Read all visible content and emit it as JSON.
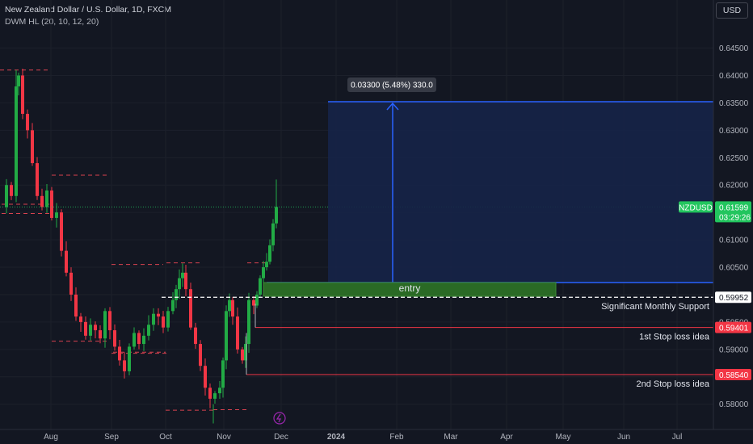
{
  "header": {
    "title": "New Zealand Dollar / U.S. Dollar, 1D, FXCM",
    "indicator": "DWM HL (20, 10, 12, 20)",
    "currency_button": "USD"
  },
  "colors": {
    "background": "#131722",
    "up_candle": "#22ab45",
    "down_candle": "#f23645",
    "accent_blue": "#2962ff",
    "measure_fill": "#162448",
    "entry_fill": "#2a6a25",
    "stop_line": "#f23645",
    "current_price": "#22c55e",
    "dashed_red": "#d8424f"
  },
  "chart_data": {
    "type": "candlestick",
    "symbol": "NZDUSD",
    "ylim": [
      0.577,
      0.6495
    ],
    "y_ticks": [
      "0.64500",
      "0.64000",
      "0.63500",
      "0.63000",
      "0.62500",
      "0.62000",
      "0.61500",
      "0.61000",
      "0.60500",
      "0.60000",
      "0.59500",
      "0.59000",
      "0.58500",
      "0.58000"
    ],
    "x_ticks": [
      "Aug",
      "Sep",
      "Oct",
      "Nov",
      "Dec",
      "2024",
      "Feb",
      "Mar",
      "Apr",
      "May",
      "Jun",
      "Jul"
    ],
    "price_labels": {
      "current": "0.61599",
      "countdown": "03:29:26",
      "support": "0.59952",
      "stop1": "0.59401",
      "stop2": "0.58540"
    },
    "annotations": {
      "entry": "entry",
      "support": "Significant Monthly Support",
      "stop1": "1st Stop loss idea",
      "stop2": "2nd Stop loss idea",
      "measure": "0.03300 (5.48%) 330.0"
    },
    "levels": {
      "target": 0.6352,
      "entry_top": 0.6022,
      "entry_bottom": 0.5997,
      "support": 0.59952,
      "stop1": 0.59401,
      "stop2": 0.5854,
      "current": 0.61599
    }
  }
}
